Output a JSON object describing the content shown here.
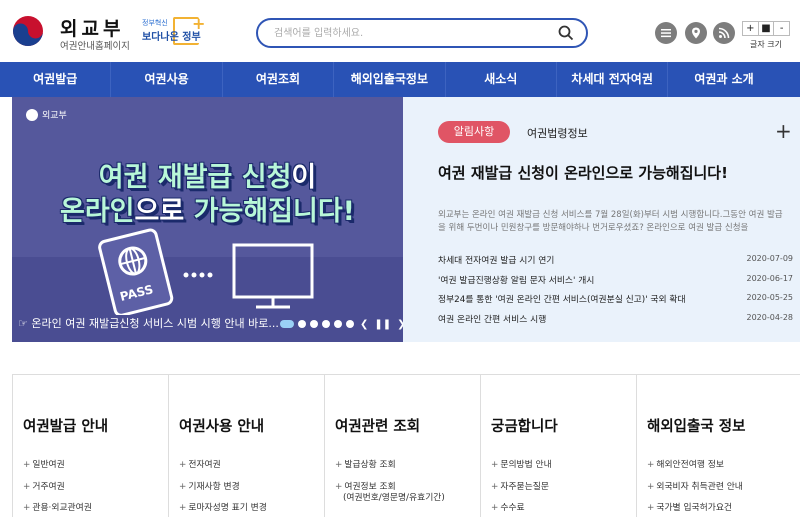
{
  "header": {
    "logo_title": "외교부",
    "logo_subtitle": "여권안내홈페이지",
    "gov_small": "정부혁신",
    "gov_big": "보다나은 정부",
    "search_placeholder": "검색어를 입력하세요.",
    "font_size_plus": "+",
    "font_size_default": "■",
    "font_size_minus": "-",
    "font_size_label": "글자 크기"
  },
  "nav": {
    "items": [
      "여권발급",
      "여권사용",
      "여권조회",
      "해외입출국정보",
      "새소식",
      "차세대 전자여권",
      "여권과 소개"
    ]
  },
  "banner": {
    "logo_text": "외교부",
    "line1_a": "여권 재발급 신청",
    "line1_b": "이",
    "line2_a": "온라인",
    "line2_b": "으로",
    "line2_c": " 가능해집니다!",
    "passport_text": "PASS",
    "caption": "☞ 온라인 여권 재발급신청 서비스 시범 시행 안내 바로...",
    "pager_prev": "❮",
    "pager_pause": "❚❚",
    "pager_next": "❯"
  },
  "news": {
    "tab_active": "알림사항",
    "tab_other": "여권법령정보",
    "more": "+",
    "title": "여권 재발급 신청이 온라인으로 가능해집니다!",
    "desc": "외교부는 온라인 여권 재발급 신청 서비스를 7월 28일(화)부터 시범 시행합니다.그동안 여권 발급을 위해 두번이나 민원창구를 방문해야하나 번거로우셨죠? 온라인으로 여권 발급 신청을",
    "items": [
      {
        "text": "차세대 전자여권 발급 시기 연기",
        "date": "2020-07-09"
      },
      {
        "text": "'여권 발급진행상황 알림 문자 서비스' 개시",
        "date": "2020-06-17"
      },
      {
        "text": "정부24를 통한 '여권 온라인 간편 서비스(여권분실 신고)' 국외 확대",
        "date": "2020-05-25"
      },
      {
        "text": "여권 온라인 간편 서비스 시행",
        "date": "2020-04-28"
      }
    ]
  },
  "quick": {
    "columns": [
      {
        "title": "여권발급 안내",
        "items": [
          "일반여권",
          "거주여권",
          "관용·외교관여권"
        ]
      },
      {
        "title": "여권사용 안내",
        "items": [
          "전자여권",
          "기재사항 변경",
          "로마자성명 표기 변경"
        ]
      },
      {
        "title": "여권관련 조회",
        "items": [
          "발급상황 조회",
          "여권정보 조회"
        ],
        "sub": "(여권번호/영문명/유효기간)"
      },
      {
        "title": "궁금합니다",
        "items": [
          "문의방법 안내",
          "자주묻는질문",
          "수수료"
        ]
      },
      {
        "title": "해외입출국 정보",
        "items": [
          "해외안전여행 정보",
          "외국비자 취득관련 안내",
          "국가별 입국허가요건"
        ]
      }
    ]
  },
  "colors": {
    "nav_bg": "#2952b5",
    "banner_bg": "#55589c",
    "news_bg": "#eaf2fb",
    "tab_active": "#e05565",
    "banner_text": "#b8f7d8"
  }
}
